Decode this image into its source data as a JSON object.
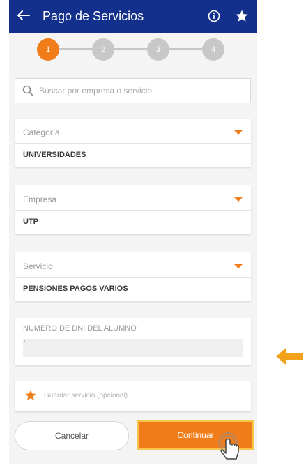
{
  "header": {
    "title": "Pago de Servicios",
    "bg_color": "#12308c",
    "icons": [
      "back-arrow-icon",
      "info-icon",
      "star-icon"
    ]
  },
  "stepper": {
    "steps": [
      "1",
      "2",
      "3",
      "4"
    ],
    "active_step": 1,
    "active_color": "#f07d19"
  },
  "search": {
    "placeholder": "Buscar por empresa o servicio"
  },
  "fields": {
    "category": {
      "label": "Categoría",
      "value": "UNIVERSIDADES"
    },
    "company": {
      "label": "Empresa",
      "value": "UTP"
    },
    "service": {
      "label": "Servicio",
      "value": "PENSIONES PAGOS VARIOS"
    }
  },
  "dni": {
    "label": "NUMERO DE DNI DEL ALUMNO",
    "value": ""
  },
  "save_service": {
    "label": "Guardar servicio (opcional)"
  },
  "buttons": {
    "cancel": "Cancelar",
    "continue": "Continuar"
  },
  "accent_color": "#f07d19"
}
